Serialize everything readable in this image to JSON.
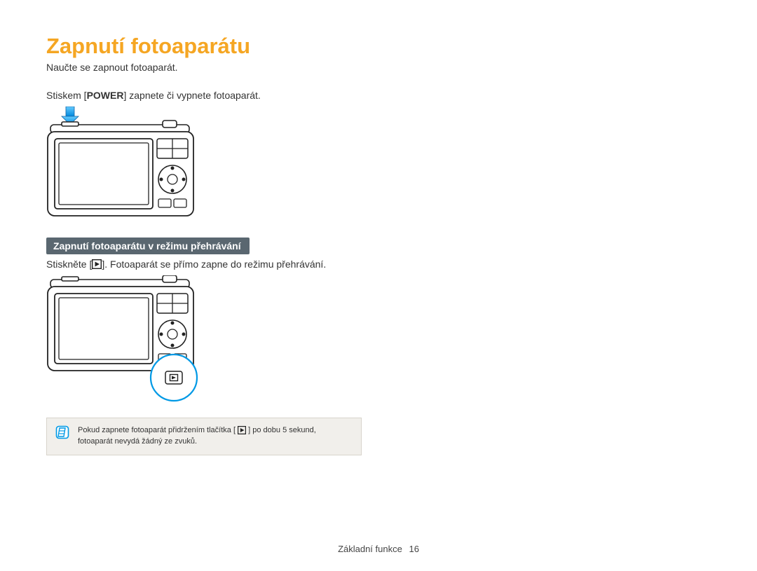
{
  "title": "Zapnutí fotoaparátu",
  "subtitle": "Naučte se zapnout fotoaparát.",
  "instruction1_pre": "Stiskem [",
  "instruction1_bold": "POWER",
  "instruction1_post": "] zapnete či vypnete fotoaparát.",
  "subheading": "Zapnutí fotoaparátu v režimu přehrávání",
  "instruction2_pre": "Stiskněte [",
  "instruction2_post": "]. Fotoaparát se přímo zapne do režimu přehrávání.",
  "callout_pre": "Pokud zapnete fotoaparát přidržením tlačítka [",
  "callout_post": "] po dobu 5 sekund, fotoaparát nevydá žádný ze zvuků.",
  "footer_label": "Základní funkce",
  "footer_page": "16"
}
